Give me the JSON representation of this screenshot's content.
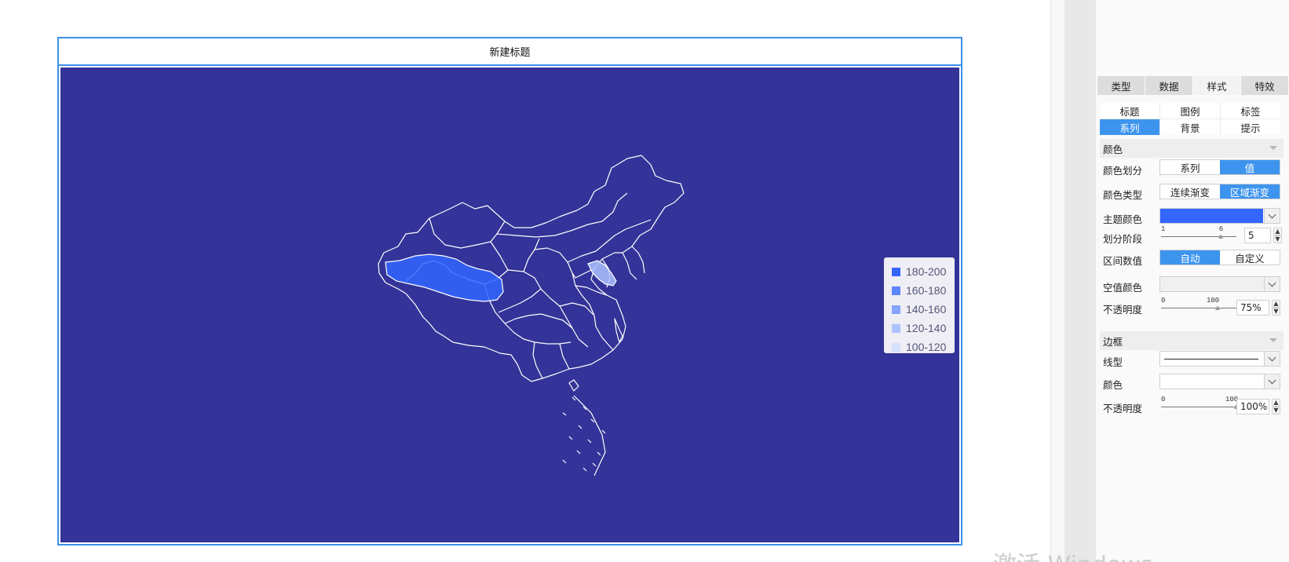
{
  "chart": {
    "title": "新建标题",
    "background_color": "#333399",
    "outline_color": "#ffffff"
  },
  "chart_data": {
    "type": "map",
    "map": "China",
    "legend_placement": "right",
    "legend": [
      {
        "label": "180-200",
        "color": "#3366ff"
      },
      {
        "label": "160-180",
        "color": "#5c85ff"
      },
      {
        "label": "140-160",
        "color": "#85a3ff"
      },
      {
        "label": "120-140",
        "color": "#adc2ff"
      },
      {
        "label": "100-120",
        "color": "#d6e0ff"
      }
    ],
    "highlighted_regions": [
      {
        "region": "Tibet",
        "range": "180-200"
      },
      {
        "region": "Jiangsu",
        "range": "120-140"
      }
    ]
  },
  "panel": {
    "main_tabs": [
      {
        "label": "类型",
        "active": false
      },
      {
        "label": "数据",
        "active": false
      },
      {
        "label": "样式",
        "active": true
      },
      {
        "label": "特效",
        "active": false
      }
    ],
    "sub_tabs": [
      {
        "label": "标题",
        "active": false
      },
      {
        "label": "图例",
        "active": false
      },
      {
        "label": "标签",
        "active": false
      },
      {
        "label": "系列",
        "active": true
      },
      {
        "label": "背景",
        "active": false
      },
      {
        "label": "提示",
        "active": false
      }
    ],
    "color_section": "颜色",
    "color_division": {
      "label": "颜色划分",
      "options": [
        "系列",
        "值"
      ],
      "active": 1
    },
    "color_type": {
      "label": "颜色类型",
      "options": [
        "连续渐变",
        "区域渐变"
      ],
      "active": 1
    },
    "theme_color": {
      "label": "主题颜色",
      "value": "#3366ff"
    },
    "stages": {
      "label": "划分阶段",
      "min": "1",
      "max": "6",
      "value": "5",
      "fraction": 0.8
    },
    "interval_value": {
      "label": "区间数值",
      "options": [
        "自动",
        "自定义"
      ],
      "active": 0
    },
    "null_color": {
      "label": "空值颜色"
    },
    "opacity": {
      "label": "不透明度",
      "min": "0",
      "max": "100",
      "value": "75%",
      "fraction": 0.75
    },
    "border_section": "边框",
    "line_type": {
      "label": "线型"
    },
    "border_color": {
      "label": "颜色"
    },
    "border_opacity": {
      "label": "不透明度",
      "min": "0",
      "max": "100",
      "value": "100%",
      "fraction": 1.0
    }
  },
  "watermark": "激活 Windows"
}
